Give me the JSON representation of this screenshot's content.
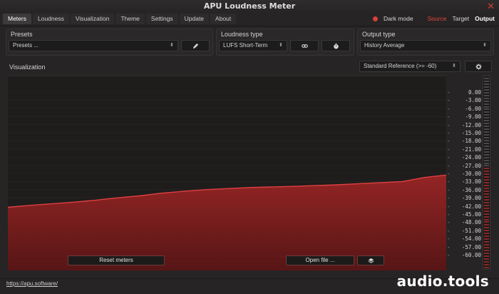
{
  "window": {
    "title": "APU Loudness Meter"
  },
  "menu": {
    "tabs": [
      {
        "label": "Meters"
      },
      {
        "label": "Loudness"
      },
      {
        "label": "Visualization"
      },
      {
        "label": "Theme"
      },
      {
        "label": "Settings"
      },
      {
        "label": "Update"
      },
      {
        "label": "About"
      }
    ]
  },
  "mode": {
    "dark_mode": "Dark mode",
    "source": "Source",
    "target": "Target",
    "output": "Output"
  },
  "presets": {
    "title": "Presets",
    "value": "Presets ..."
  },
  "loudness_type": {
    "title": "Loudness type",
    "value": "LUFS Short-Term"
  },
  "output_type": {
    "title": "Output type",
    "value": "History Average"
  },
  "visualization": {
    "title": "Visualization",
    "reference": "Standard Reference (>= -60)"
  },
  "scale": {
    "ticks": [
      "0.00",
      "-3.00",
      "-6.00",
      "-9.00",
      "-12.00",
      "-15.00",
      "-18.00",
      "-21.00",
      "-24.00",
      "-27.00",
      "-30.00",
      "-33.00",
      "-36.00",
      "-39.00",
      "-42.00",
      "-45.00",
      "-48.00",
      "-51.00",
      "-54.00",
      "-57.00",
      "-60.00"
    ]
  },
  "buttons": {
    "reset": "Reset meters",
    "open": "Open file ..."
  },
  "footer": {
    "link": "https://apu.software/",
    "watermark": "audio.tools"
  },
  "colors": {
    "accent": "#e2453e",
    "fill": "#8a2222",
    "line": "#d23a3a"
  },
  "chart_data": {
    "type": "area",
    "ylim": [
      -60,
      0
    ],
    "x": [
      0,
      0.05,
      0.1,
      0.15,
      0.2,
      0.25,
      0.3,
      0.35,
      0.4,
      0.45,
      0.5,
      0.55,
      0.6,
      0.65,
      0.7,
      0.75,
      0.8,
      0.85,
      0.9,
      0.95,
      1.0
    ],
    "values": [
      -42.5,
      -41.8,
      -41.2,
      -40.6,
      -39.9,
      -39.0,
      -38.3,
      -37.3,
      -36.6,
      -36.0,
      -35.6,
      -35.2,
      -35.0,
      -34.8,
      -34.5,
      -34.2,
      -33.8,
      -33.4,
      -33.0,
      -31.5,
      -30.6
    ]
  }
}
